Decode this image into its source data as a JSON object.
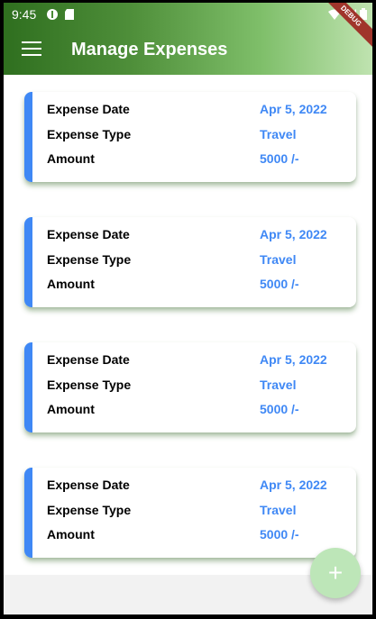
{
  "status_bar": {
    "time": "9:45"
  },
  "app_bar": {
    "title": "Manage Expenses",
    "debug_banner": "DEBUG"
  },
  "fab": {
    "icon": "+"
  },
  "expenses": [
    {
      "date_label": "Expense Date",
      "date": "Apr 5, 2022",
      "type_label": "Expense Type",
      "type": "Travel",
      "amount_label": "Amount",
      "amount": "5000 /-"
    },
    {
      "date_label": "Expense Date",
      "date": "Apr 5, 2022",
      "type_label": "Expense Type",
      "type": "Travel",
      "amount_label": "Amount",
      "amount": "5000 /-"
    },
    {
      "date_label": "Expense Date",
      "date": "Apr 5, 2022",
      "type_label": "Expense Type",
      "type": "Travel",
      "amount_label": "Amount",
      "amount": "5000 /-"
    },
    {
      "date_label": "Expense Date",
      "date": "Apr 5, 2022",
      "type_label": "Expense Type",
      "type": "Travel",
      "amount_label": "Amount",
      "amount": "5000 /-"
    }
  ],
  "colors": {
    "accent": "#3f88f5",
    "appbar_start": "#2f6f1f",
    "appbar_end": "#bfe3b0",
    "fab": "#bde6b8"
  }
}
